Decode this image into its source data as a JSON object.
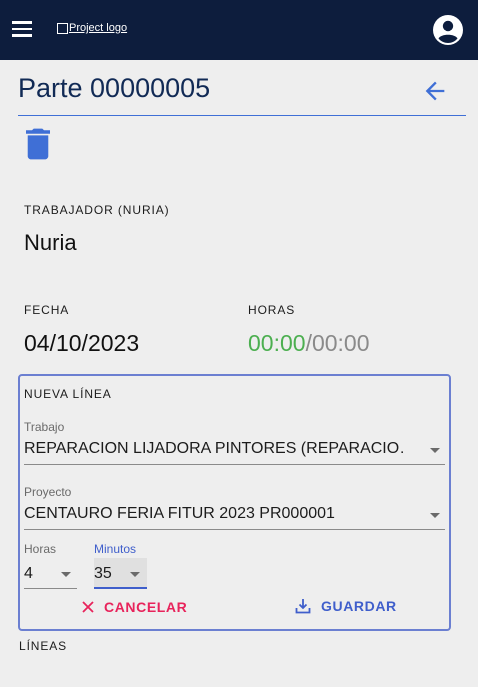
{
  "header": {
    "logo_alt": "Project logo"
  },
  "page": {
    "title": "Parte 00000005"
  },
  "worker": {
    "label": "TRABAJADOR (NURIA)",
    "value": "Nuria"
  },
  "date": {
    "label": "FECHA",
    "value": "04/10/2023"
  },
  "hours": {
    "label": "HORAS",
    "done": "00:00",
    "separator": "/",
    "total": "00:00"
  },
  "new_line": {
    "title": "NUEVA LÍNEA",
    "trabajo_label": "Trabajo",
    "trabajo_value": "REPARACION LIJADORA PINTORES (REPARACIO…",
    "proyecto_label": "Proyecto",
    "proyecto_value": "CENTAURO FERIA FITUR 2023 PR000001",
    "horas_label": "Horas",
    "horas_value": "4",
    "minutos_label": "Minutos",
    "minutos_value": "35",
    "cancel_label": "CANCELAR",
    "save_label": "GUARDAR"
  },
  "lines": {
    "label": "LÍNEAS"
  },
  "colors": {
    "topbar": "#0d1d3d",
    "accent": "#3f6fd6",
    "cancel": "#e8235b",
    "save": "#3f5ecb",
    "hours_done": "#4caf50"
  }
}
